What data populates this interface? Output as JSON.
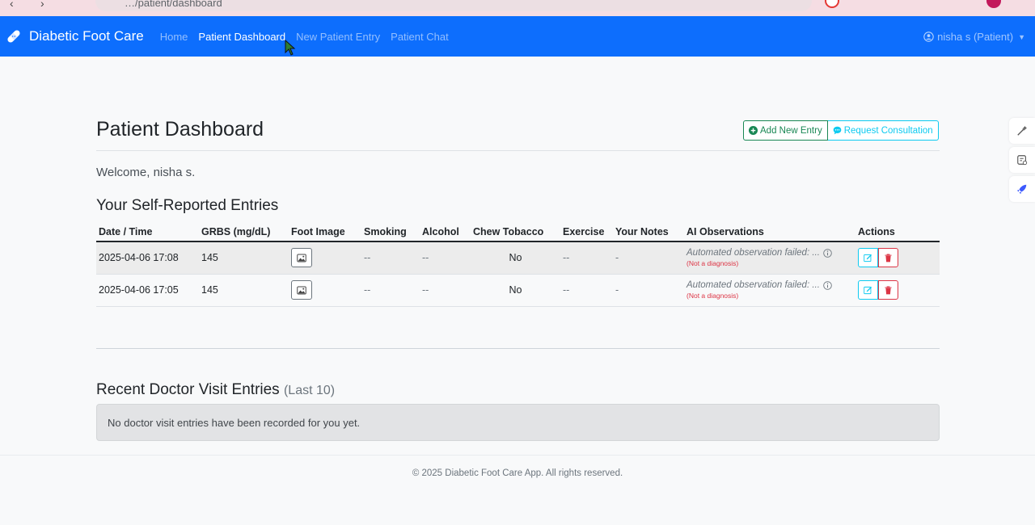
{
  "browser": {
    "url": "…/patient/dashboard"
  },
  "navbar": {
    "brand": "Diabetic Foot Care",
    "links": [
      {
        "label": "Home"
      },
      {
        "label": "Patient Dashboard",
        "active": true
      },
      {
        "label": "New Patient Entry"
      },
      {
        "label": "Patient Chat"
      }
    ],
    "user": "nisha s (Patient)"
  },
  "page": {
    "title": "Patient Dashboard",
    "add_entry_label": "Add New Entry",
    "consult_label": "Request Consultation",
    "welcome": "Welcome, nisha s."
  },
  "self_reported": {
    "title": "Your Self-Reported Entries",
    "headers": [
      "Date / Time",
      "GRBS (mg/dL)",
      "Foot Image",
      "Smoking",
      "Alcohol",
      "Chew Tobacco",
      "Exercise",
      "Your Notes",
      "AI Observations",
      "Actions"
    ],
    "rows": [
      {
        "datetime": "2025-04-06 17:08",
        "grbs": "145",
        "smoking": "--",
        "alcohol": "--",
        "tobacco": "No",
        "exercise": "--",
        "notes": "-",
        "ai": "Automated observation failed: ...",
        "ai_note": "(Not a diagnosis)"
      },
      {
        "datetime": "2025-04-06 17:05",
        "grbs": "145",
        "smoking": "--",
        "alcohol": "--",
        "tobacco": "No",
        "exercise": "--",
        "notes": "-",
        "ai": "Automated observation failed: ...",
        "ai_note": "(Not a diagnosis)"
      }
    ]
  },
  "doctor_visits": {
    "title": "Recent Doctor Visit Entries",
    "subtitle": "(Last 10)",
    "empty_message": "No doctor visit entries have been recorded for you yet."
  },
  "footer": {
    "text": "© 2025 Diabetic Foot Care App. All rights reserved."
  },
  "colors": {
    "navbar": "#0d6efd",
    "success": "#198754",
    "info": "#0dcaf0",
    "danger": "#dc3545"
  },
  "icons": [
    "bandage-icon",
    "user-circle-icon",
    "plus-circle-icon",
    "chat-icon",
    "image-icon",
    "info-icon",
    "edit-icon",
    "trash-icon",
    "magic-pen-icon",
    "note-icon",
    "rocket-icon"
  ]
}
